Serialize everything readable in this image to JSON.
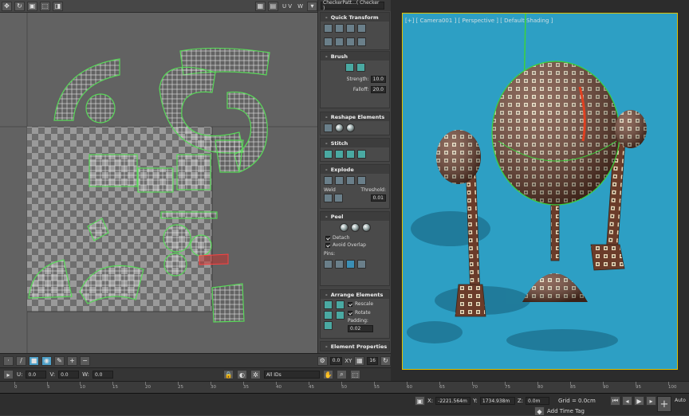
{
  "uv_editor": {
    "toolbar_labels": {
      "uv": "U V",
      "w": "W"
    },
    "status": {
      "u_label": "U:",
      "v_label": "V:",
      "w_label": "W:",
      "u_value": "0.0",
      "v_value": "0.0",
      "w_value": "0.0",
      "zoom_value": "0.0",
      "grid_value": "16",
      "xy_label": "XY",
      "filter_value": "All IDs"
    }
  },
  "panel": {
    "texture_dropdown": "CheckerPatt...( Checker )",
    "rollouts": {
      "quick_transform": "Quick Transform",
      "brush": "Brush",
      "strength_label": "Strength:",
      "strength_value": "10.0",
      "falloff_label": "Falloff:",
      "falloff_value": "20.0",
      "reshape": "Reshape Elements",
      "stitch": "Stitch",
      "explode": "Explode",
      "weld_label": "Weld",
      "threshold_label": "Threshold:",
      "threshold_value": "0.01",
      "peel": "Peel",
      "detach_label": "Detach",
      "avoid_overlap_label": "Avoid Overlap",
      "pins_label": "Pins:",
      "arrange": "Arrange Elements",
      "rescale_label": "Rescale",
      "rotate_label": "Rotate",
      "padding_label": "Padding:",
      "padding_value": "0.02",
      "element_props": "Element Properties"
    }
  },
  "viewport": {
    "label": "[+] [ Camera001 ] [ Perspective ] [ Default Shading ]"
  },
  "timeline": {
    "ticks": [
      "0",
      "5",
      "10",
      "15",
      "20",
      "25",
      "30",
      "35",
      "40",
      "45",
      "50",
      "55",
      "60",
      "65",
      "70",
      "75",
      "80",
      "85",
      "90",
      "95",
      "100"
    ]
  },
  "bottom_bar": {
    "x_label": "X:",
    "x_value": "-2221.564m",
    "y_label": "Y:",
    "y_value": "1734.938m",
    "z_label": "Z:",
    "z_value": "0.0m",
    "grid": "Grid = 0.0cm",
    "add_time_tag": "Add Time Tag",
    "auto_label": "Auto"
  },
  "colors": {
    "uv_wire": "#e8e8e8",
    "uv_selected": "#4cc94c",
    "viewport_bg": "#2d9fc4",
    "frame": "#e0c000",
    "accent_button": "#4ea0c8"
  }
}
